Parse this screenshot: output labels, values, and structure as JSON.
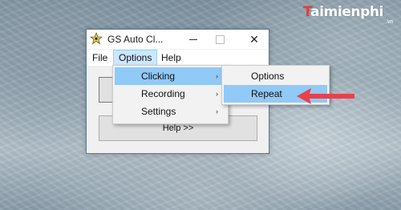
{
  "watermark": {
    "logo_initial": "T",
    "logo_rest": "aimienphi",
    "sub": ".vn"
  },
  "window": {
    "title": "GS Auto Cl...",
    "icons": {
      "app": "star-icon",
      "minimize": "minimize-icon",
      "maximize": "maximize-icon",
      "close": "close-icon"
    },
    "close_glyph": "✕"
  },
  "menubar": {
    "items": [
      {
        "label": "File"
      },
      {
        "label": "Options"
      },
      {
        "label": "Help"
      }
    ]
  },
  "client": {
    "help_button": "Help >>"
  },
  "options_menu": {
    "items": [
      {
        "label": "Clicking",
        "submenu": true,
        "highlighted": true
      },
      {
        "label": "Recording",
        "submenu": true,
        "highlighted": false
      },
      {
        "label": "Settings",
        "submenu": true,
        "highlighted": false
      }
    ],
    "arrow_glyph": "›"
  },
  "clicking_menu": {
    "items": [
      {
        "label": "Options",
        "highlighted": false
      },
      {
        "label": "Repeat",
        "highlighted": true
      }
    ]
  },
  "colors": {
    "menu_highlight": "#91c9f7",
    "menubar_selected": "#cce8ff",
    "annotation_arrow": "#e8414a",
    "window_border": "#5a7996"
  },
  "annotation": {
    "icon": "red-arrow-icon",
    "points_to": "Repeat"
  }
}
